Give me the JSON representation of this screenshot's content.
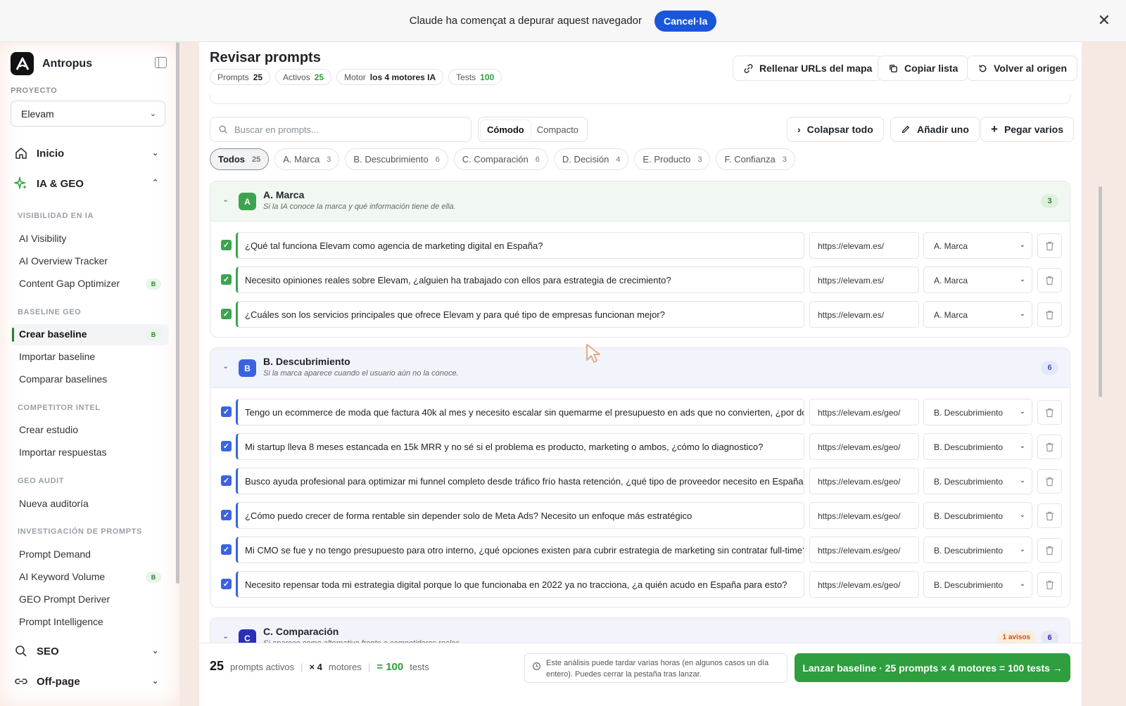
{
  "banner": {
    "message": "Claude ha començat a depurar aquest navegador",
    "cancel": "Cancel·la"
  },
  "sidebar": {
    "brand": "Antropus",
    "project_label": "PROYECTO",
    "project_value": "Elevam",
    "nav": {
      "inicio": "Inicio",
      "ia_geo": "IA & GEO",
      "seo": "SEO",
      "offpage": "Off-page"
    },
    "sections": {
      "visibilidad": {
        "title": "VISIBILIDAD EN IA",
        "items": [
          "AI Visibility",
          "AI Overview Tracker",
          "Content Gap Optimizer"
        ]
      },
      "baseline": {
        "title": "BASELINE GEO",
        "items": [
          "Crear baseline",
          "Importar baseline",
          "Comparar baselines"
        ]
      },
      "competitor": {
        "title": "COMPETITOR INTEL",
        "items": [
          "Crear estudio",
          "Importar respuestas"
        ]
      },
      "audit": {
        "title": "GEO AUDIT",
        "items": [
          "Nueva auditoría"
        ]
      },
      "prompts": {
        "title": "INVESTIGACIÓN DE PROMPTS",
        "items": [
          "Prompt Demand",
          "AI Keyword Volume",
          "GEO Prompt Deriver",
          "Prompt Intelligence"
        ]
      }
    },
    "beta": "B"
  },
  "header": {
    "title": "Revisar prompts",
    "chips": {
      "prompts_label": "Prompts",
      "prompts_val": "25",
      "activos_label": "Activos",
      "activos_val": "25",
      "motor_label": "Motor",
      "motor_val": "los 4 motores IA",
      "tests_label": "Tests",
      "tests_val": "100"
    },
    "buttons": {
      "rellenar": "Rellenar URLs del mapa",
      "copiar": "Copiar lista",
      "volver": "Volver al origen"
    }
  },
  "toolbar": {
    "search_placeholder": "Buscar en prompts...",
    "view_comodo": "Cómodo",
    "view_compacto": "Compacto",
    "colapsar": "Colapsar todo",
    "anadir": "Añadir uno",
    "pegar": "Pegar varios"
  },
  "filters": [
    {
      "label": "Todos",
      "count": "25"
    },
    {
      "label": "A. Marca",
      "count": "3"
    },
    {
      "label": "B. Descubrimiento",
      "count": "6"
    },
    {
      "label": "C. Comparación",
      "count": "6"
    },
    {
      "label": "D. Decisión",
      "count": "4"
    },
    {
      "label": "E. Producto",
      "count": "3"
    },
    {
      "label": "F. Confianza",
      "count": "3"
    }
  ],
  "groups": {
    "a": {
      "letter": "A",
      "title": "A. Marca",
      "subtitle": "Si la IA conoce la marca y qué información tiene de ella.",
      "count": "3",
      "color": "#3ea34f",
      "rows": [
        {
          "text": "¿Qué tal funciona Elevam como agencia de marketing digital en España?",
          "url": "https://elevam.es/",
          "cat": "A. Marca"
        },
        {
          "text": "Necesito opiniones reales sobre Elevam, ¿alguien ha trabajado con ellos para estrategia de crecimiento?",
          "url": "https://elevam.es/",
          "cat": "A. Marca"
        },
        {
          "text": "¿Cuáles son los servicios principales que ofrece Elevam y para qué tipo de empresas funcionan mejor?",
          "url": "https://elevam.es/",
          "cat": "A. Marca"
        }
      ]
    },
    "b": {
      "letter": "B",
      "title": "B. Descubrimiento",
      "subtitle": "Si la marca aparece cuando el usuario aún no la conoce.",
      "count": "6",
      "color": "#3a63e0",
      "rows": [
        {
          "text": "Tengo un ecommerce de moda que factura 40k al mes y necesito escalar sin quemarme el presupuesto en ads que no convierten, ¿por dónde er",
          "url": "https://elevam.es/geo/",
          "cat": "B. Descubrimiento"
        },
        {
          "text": "Mi startup lleva 8 meses estancada en 15k MRR y no sé si el problema es producto, marketing o ambos, ¿cómo lo diagnostico?",
          "url": "https://elevam.es/geo/",
          "cat": "B. Descubrimiento"
        },
        {
          "text": "Busco ayuda profesional para optimizar mi funnel completo desde tráfico frío hasta retención, ¿qué tipo de proveedor necesito en España?",
          "url": "https://elevam.es/geo/",
          "cat": "B. Descubrimiento"
        },
        {
          "text": "¿Cómo puedo crecer de forma rentable sin depender solo de Meta Ads? Necesito un enfoque más estratégico",
          "url": "https://elevam.es/geo/",
          "cat": "B. Descubrimiento"
        },
        {
          "text": "Mi CMO se fue y no tengo presupuesto para otro interno, ¿qué opciones existen para cubrir estrategia de marketing sin contratar full-time?",
          "url": "https://elevam.es/geo/",
          "cat": "B. Descubrimiento"
        },
        {
          "text": "Necesito repensar toda mi estrategia digital porque lo que funcionaba en 2022 ya no tracciona, ¿a quién acudo en España para esto?",
          "url": "https://elevam.es/geo/",
          "cat": "B. Descubrimiento"
        }
      ]
    },
    "c": {
      "letter": "C",
      "title": "C. Comparación",
      "subtitle": "Si aparece como alternativa frente a competidores reales.",
      "count": "6",
      "warnings": "1 avisos",
      "color": "#2a2fb8"
    }
  },
  "footer": {
    "active_count": "25",
    "active_label": "prompts activos",
    "motores": "× 4",
    "motores_label": "motores",
    "tests": "= 100",
    "tests_label": "tests",
    "note": "Este análisis puede tardar varias horas (en algunos casos un día entero). Puedes cerrar la pestaña tras lanzar.",
    "launch": "Lanzar baseline · 25 prompts × 4 motores = 100 tests →"
  }
}
